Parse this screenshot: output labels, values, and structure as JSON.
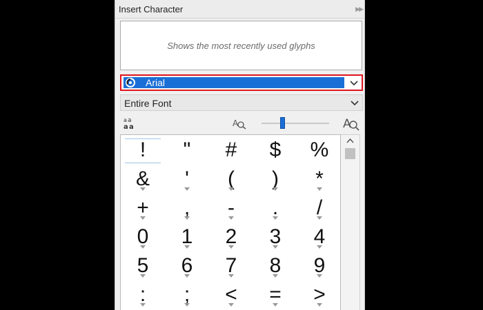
{
  "panel": {
    "title": "Insert Character",
    "recent_placeholder": "Shows the most recently used glyphs"
  },
  "font_select": {
    "value": "Arial"
  },
  "range_select": {
    "value": "Entire Font"
  },
  "toolbar": {
    "zoom_level": 0.3,
    "icons": [
      "font-size-toggle-icon",
      "zoom-out-icon",
      "zoom-in-icon"
    ]
  },
  "glyph_grid": {
    "rows": [
      [
        "!",
        "\"",
        "#",
        "$",
        "%"
      ],
      [
        "&",
        "'",
        "(",
        ")",
        "*"
      ],
      [
        "+",
        ",",
        "-",
        ".",
        "/"
      ],
      [
        "0",
        "1",
        "2",
        "3",
        "4"
      ],
      [
        "5",
        "6",
        "7",
        "8",
        "9"
      ],
      [
        ":",
        ";",
        "<",
        "=",
        ">"
      ]
    ],
    "selected": "!"
  },
  "colors": {
    "accent": "#1a6fd6",
    "highlight_border": "#e0141e"
  }
}
